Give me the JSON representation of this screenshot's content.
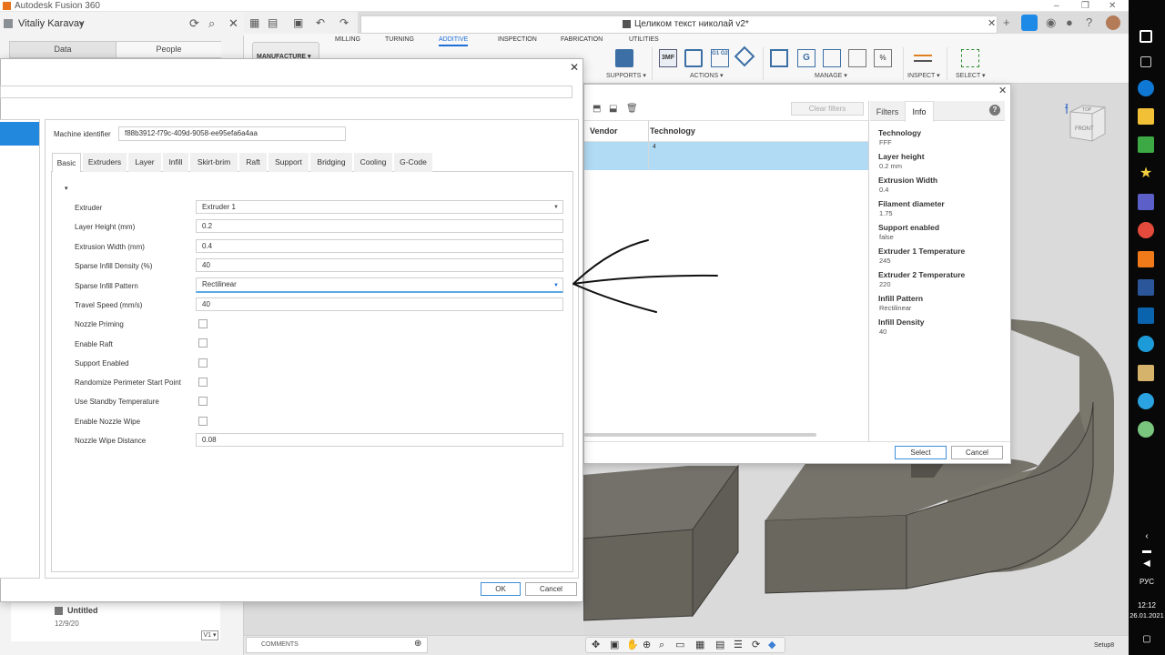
{
  "titlebar": {
    "title": "Autodesk Fusion 360",
    "minimize": "–",
    "restore": "❐",
    "close": "✕"
  },
  "datapanel": {
    "user": "Vitaliy Karavay",
    "user_caret": "▾",
    "icons": [
      "refresh-icon",
      "search-icon",
      "close-icon"
    ],
    "tabs": [
      "Data",
      "People"
    ],
    "recent": {
      "name": "Untitled",
      "date": "12/9/20",
      "version": "V1 ▾"
    }
  },
  "document": {
    "title": "Целиком текст николай v2*",
    "close": "✕",
    "new_tab": "+"
  },
  "toolbar": {
    "workspace": "MANUFACTURE ▾",
    "tabs": [
      "MILLING",
      "TURNING",
      "ADDITIVE",
      "INSPECTION",
      "FABRICATION",
      "UTILITIES"
    ],
    "active_tab": "ADDITIVE",
    "groups": [
      "SUPPORTS ▾",
      "ACTIONS ▾",
      "MANAGE ▾",
      "INSPECT ▾",
      "SELECT ▾"
    ],
    "action_icons": [
      "3MF",
      "G1 G2"
    ]
  },
  "library": {
    "close": "✕",
    "clear_filters": "Clear filters",
    "columns": [
      "Vendor",
      "Technology"
    ],
    "row": {
      "technology": "4"
    },
    "tabs": [
      "Filters",
      "Info"
    ],
    "active_tab": "Info",
    "help": "?",
    "info": [
      {
        "key": "Technology",
        "value": "FFF"
      },
      {
        "key": "Layer height",
        "value": "0.2 mm"
      },
      {
        "key": "Extrusion Width",
        "value": "0.4"
      },
      {
        "key": "Filament diameter",
        "value": "1.75"
      },
      {
        "key": "Support enabled",
        "value": "false"
      },
      {
        "key": "Extruder 1 Temperature",
        "value": "245"
      },
      {
        "key": "Extruder 2 Temperature",
        "value": "220"
      },
      {
        "key": "Infill Pattern",
        "value": "Rectilinear"
      },
      {
        "key": "Infill Density",
        "value": "40"
      }
    ],
    "select": "Select",
    "cancel": "Cancel"
  },
  "machine": {
    "close": "✕",
    "id_label": "Machine identifier",
    "id_value": "f88b3912-f79c-409d-9058-ee95efa6a4aa",
    "tabs": [
      "Basic",
      "Extruders",
      "Layer",
      "Infill",
      "Skirt-brim",
      "Raft",
      "Support",
      "Bridging",
      "Cooling",
      "G-Code"
    ],
    "active_tab": "Basic",
    "collapse_glyph": "▾",
    "fields": {
      "extruder": {
        "label": "Extruder",
        "value": "Extruder 1"
      },
      "layer_height": {
        "label": "Layer Height (mm)",
        "value": "0.2"
      },
      "extrusion_width": {
        "label": "Extrusion Width (mm)",
        "value": "0.4"
      },
      "infill_density": {
        "label": "Sparse Infill Density (%)",
        "value": "40"
      },
      "infill_pattern": {
        "label": "Sparse Infill Pattern",
        "value": "Rectilinear"
      },
      "travel_speed": {
        "label": "Travel Speed (mm/s)",
        "value": "40"
      },
      "nozzle_priming": {
        "label": "Nozzle Priming",
        "checked": false
      },
      "enable_raft": {
        "label": "Enable Raft",
        "checked": false
      },
      "support_enabled": {
        "label": "Support Enabled",
        "checked": false
      },
      "randomize_start": {
        "label": "Randomize Perimeter Start Point",
        "checked": false
      },
      "standby_temp": {
        "label": "Use Standby Temperature",
        "checked": false
      },
      "nozzle_wipe": {
        "label": "Enable Nozzle Wipe",
        "checked": false
      },
      "wipe_distance": {
        "label": "Nozzle Wipe Distance",
        "value": "0.08"
      }
    },
    "ok": "OK",
    "cancel": "Cancel"
  },
  "viewport": {
    "viewcube_top": "TOP",
    "viewcube_front": "FRONT",
    "comments": "COMMENTS",
    "setup": "Setup8",
    "nav_icons": [
      "orbit-icon",
      "pan-icon",
      "zoom-icon",
      "display-icon",
      "grid-icon"
    ]
  },
  "taskbar": {
    "language": "РУС",
    "time": "12:12",
    "date": "26.01.2021",
    "apps": [
      "start",
      "task-view",
      "edge",
      "explorer",
      "downloads",
      "star",
      "teams",
      "chrome",
      "fusion",
      "word",
      "outlook",
      "edge-beta",
      "onenote",
      "telegram",
      "maps"
    ]
  },
  "colors": {
    "accent": "#1d8ae8",
    "selection_row": "#b1dbf4",
    "model": "#6e6b62",
    "taskbar": "#080808"
  }
}
